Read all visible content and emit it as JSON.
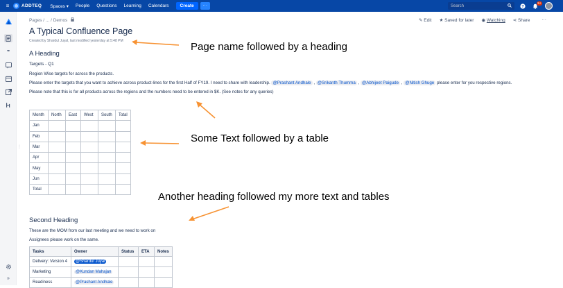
{
  "topbar": {
    "brand": "ADDTEQ",
    "nav": [
      "Spaces",
      "People",
      "Questions",
      "Learning",
      "Calendars"
    ],
    "spaces_caret": "▾",
    "create": "Create",
    "more": "···",
    "search_placeholder": "Search",
    "notification_count": "9+"
  },
  "breadcrumb": {
    "pages": "Pages",
    "ellipsis": "/ ...",
    "sep": "/",
    "current": "Demos"
  },
  "page_actions": {
    "edit": "Edit",
    "saved": "Saved for later",
    "watching": "Watching",
    "share": "Share",
    "more": "···"
  },
  "page": {
    "title": "A Typical Confluence Page",
    "byline": "Created by Shardul Juyal, last modified yesterday at 5:48 PM",
    "heading1": "A Heading",
    "subheading": "Targets - Q1",
    "para1": "Region Wise targets for across the products.",
    "para2_prefix": "Please enter the targets that you want to achieve across product-lines for the first Half of FY19. I need to share with leadership.",
    "mentions": [
      "@Prashant Andhale",
      "@Srikanth Thumma",
      "@Abhijeet Paigude",
      "@Nitish Ghuge"
    ],
    "para2_suffix": "please enter for you respective regions.",
    "para3": "Please note that this is for all products across the regions and the numbers need to be entered in $K. (See notes for any queries)",
    "heading2": "Second Heading",
    "para4": "These are the MOM from our last meeting and we need to work on",
    "para5": "Assignees please work on the same."
  },
  "table1": {
    "headers": [
      "Month",
      "North",
      "East",
      "West",
      "South",
      "Total"
    ],
    "rows": [
      "Jan",
      "Feb",
      "Mar",
      "Apr",
      "May",
      "Jun",
      "Total"
    ]
  },
  "table2": {
    "headers": [
      "Tasks",
      "Owner",
      "Status",
      "ETA",
      "Notes"
    ],
    "rows": [
      {
        "task": "Delivery: Version 4",
        "owner": "@Shardul Juyal"
      },
      {
        "task": "Marketing",
        "owner": "@Kundan Mahajan"
      },
      {
        "task": "Readiness",
        "owner": "@Prashant Andhale"
      }
    ]
  },
  "annotations": {
    "a1": "Page name followed by a heading",
    "a2": "Some Text followed by a table",
    "a3": "Another heading followed my more text and tables"
  },
  "colors": {
    "topbar": "#0747a6",
    "arrow": "#f79232",
    "link": "#0052cc"
  }
}
